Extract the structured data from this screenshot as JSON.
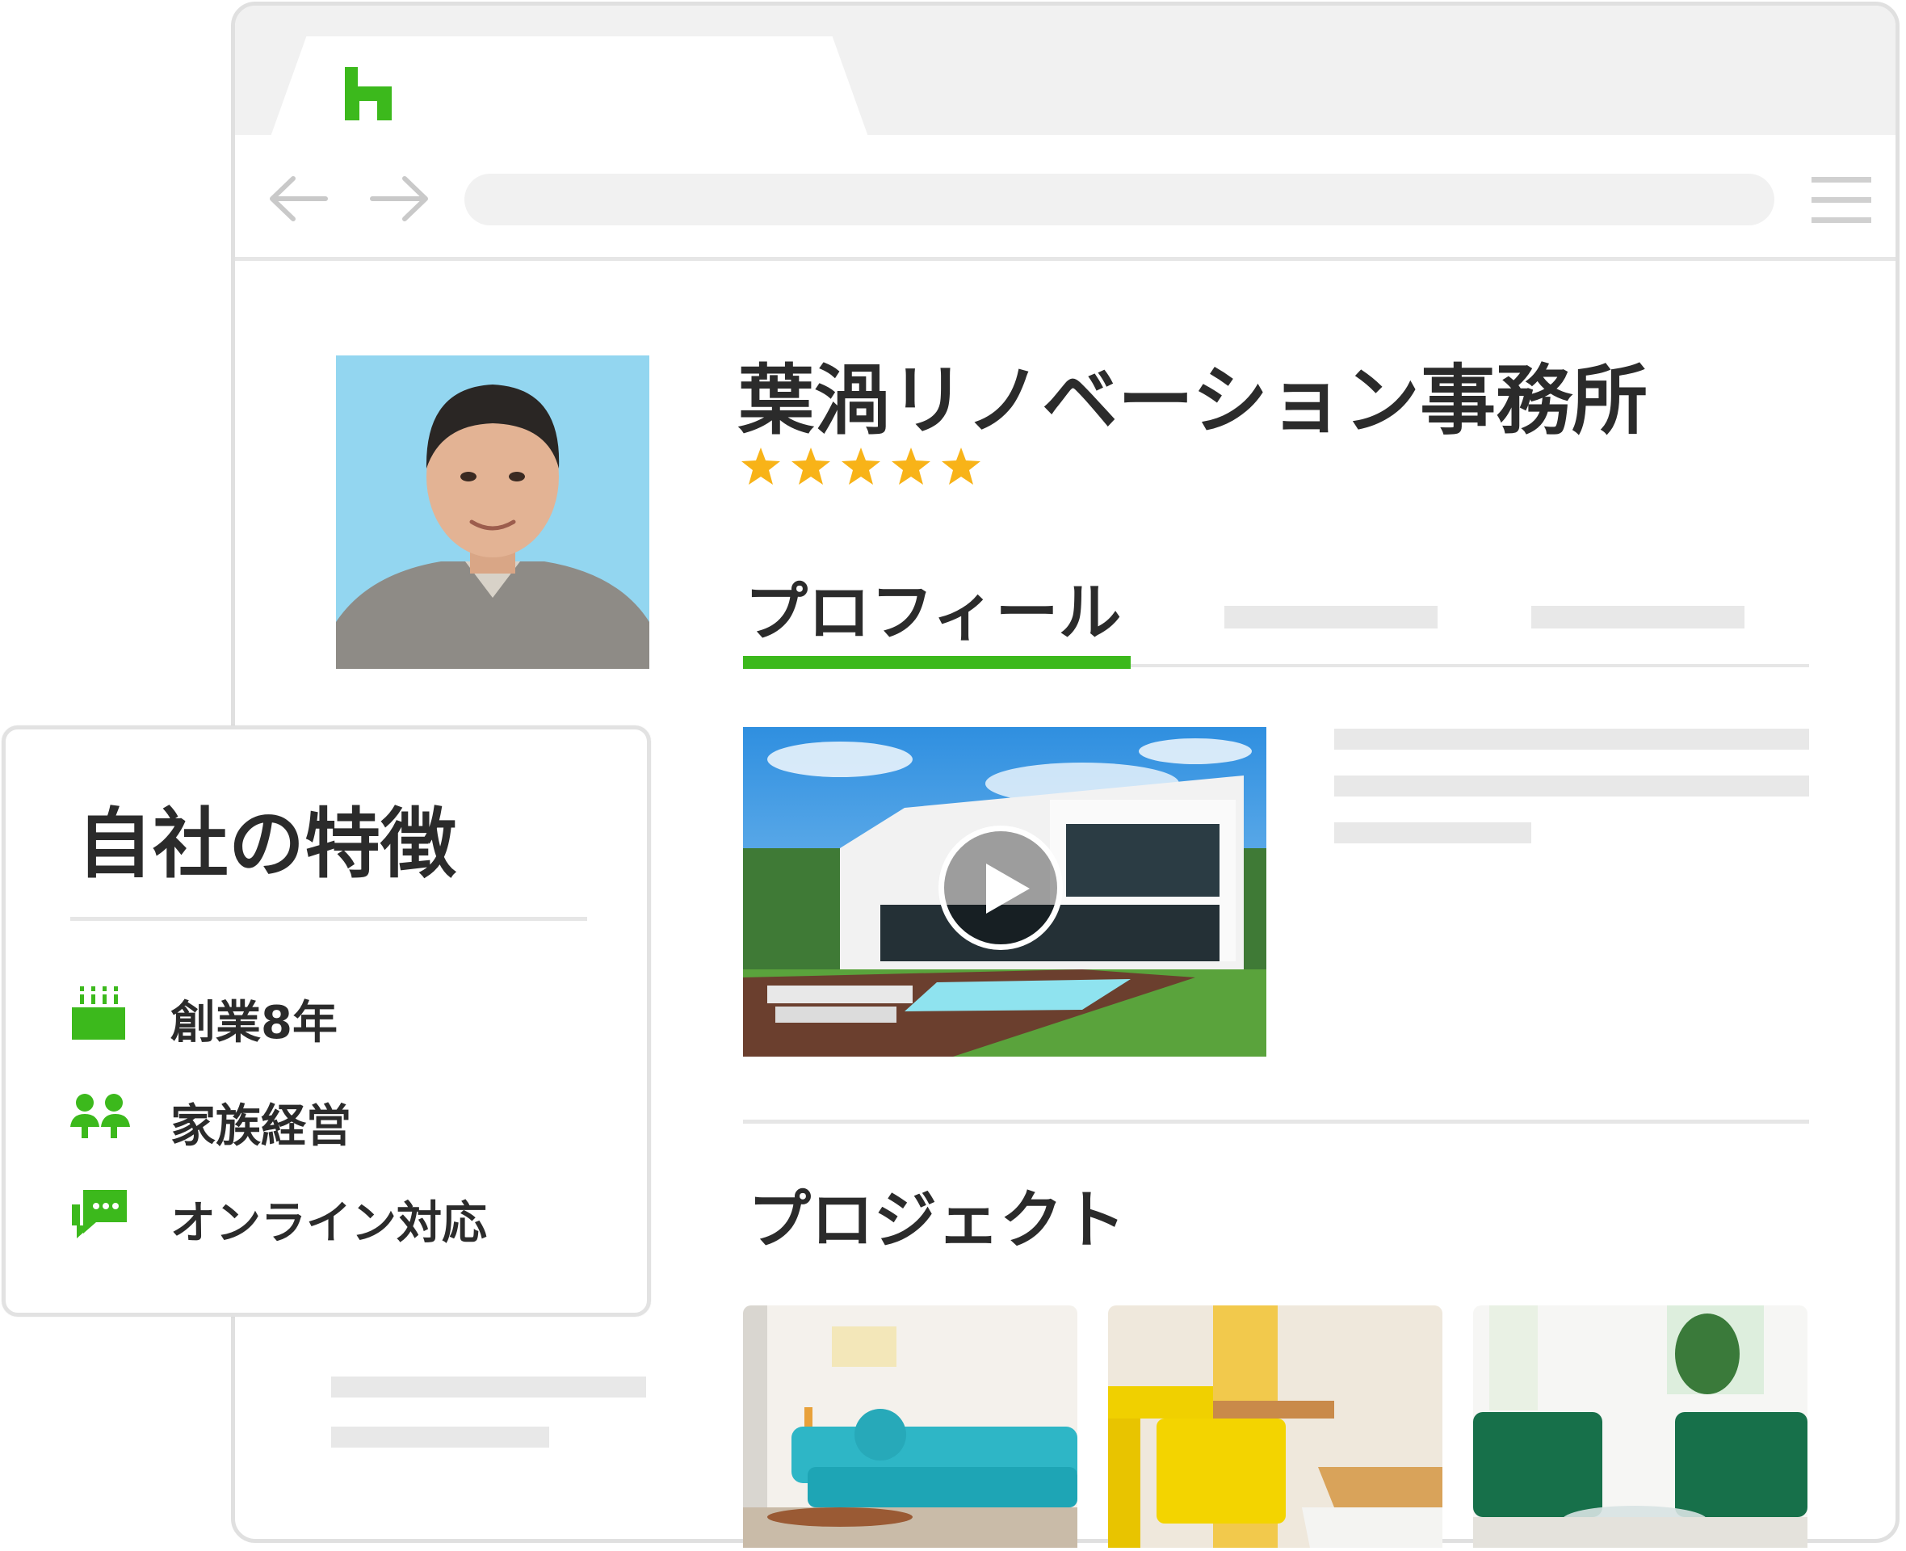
{
  "company": {
    "name": "葉渦リノベーション事務所",
    "rating": 5
  },
  "tabs": [
    {
      "label": "プロフィール",
      "active": true
    },
    {
      "label": "",
      "active": false
    },
    {
      "label": "",
      "active": false
    }
  ],
  "projects": {
    "title": "プロジェクト"
  },
  "features": {
    "title": "自社の特徴",
    "items": [
      {
        "icon": "cake-icon",
        "label": "創業8年"
      },
      {
        "icon": "family-icon",
        "label": "家族経営"
      },
      {
        "icon": "chat-icon",
        "label": "オンライン対応"
      }
    ]
  },
  "colors": {
    "accent": "#3cb91c",
    "star": "#f8b318",
    "photo_bg": "#93d6f0"
  },
  "icons": {
    "favicon": "houzz-logo-icon",
    "back": "arrow-left-icon",
    "forward": "arrow-right-icon",
    "menu": "hamburger-menu-icon",
    "play": "play-icon"
  }
}
